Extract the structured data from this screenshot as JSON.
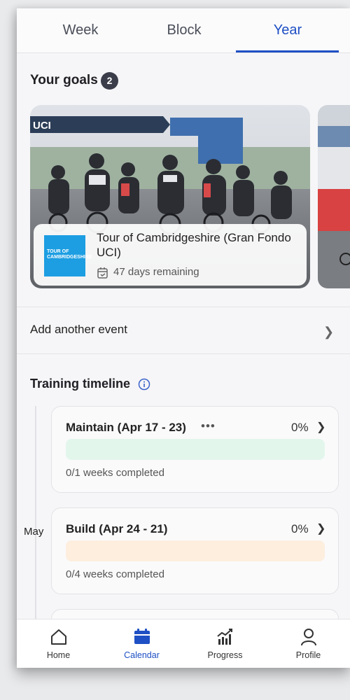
{
  "tabs": [
    {
      "label": "Week",
      "active": false
    },
    {
      "label": "Block",
      "active": false
    },
    {
      "label": "Year",
      "active": true
    }
  ],
  "goals": {
    "title": "Your goals",
    "count": "2",
    "cards": [
      {
        "name": "Tour of Cambridgeshire (Gran Fondo UCI)",
        "remaining": "47 days remaining",
        "logo_text": "TOUR OF CAMBRIDGESHIRE",
        "banner_text": "UCI"
      }
    ]
  },
  "add_event": {
    "label": "Add another event"
  },
  "timeline": {
    "title": "Training timeline",
    "month_label": "May",
    "phases": [
      {
        "name": "Maintain (Apr 17 - 23)",
        "percent": "0%",
        "progress": 0,
        "weeks": "0/1 weeks completed",
        "bar_color": "#e3f6ec",
        "has_more": true
      },
      {
        "name": "Build (Apr 24 - 21)",
        "percent": "0%",
        "progress": 0,
        "weeks": "0/4 weeks completed",
        "bar_color": "#fdeede",
        "has_more": false
      }
    ]
  },
  "nav": [
    {
      "label": "Home",
      "icon": "home-icon",
      "active": false
    },
    {
      "label": "Calendar",
      "icon": "calendar-icon",
      "active": true
    },
    {
      "label": "Progress",
      "icon": "progress-chart-icon",
      "active": false
    },
    {
      "label": "Profile",
      "icon": "profile-icon",
      "active": false
    }
  ],
  "colors": {
    "accent": "#1e4fc4",
    "badge": "#3b3e4a",
    "logo_blue": "#1d9ee2"
  }
}
